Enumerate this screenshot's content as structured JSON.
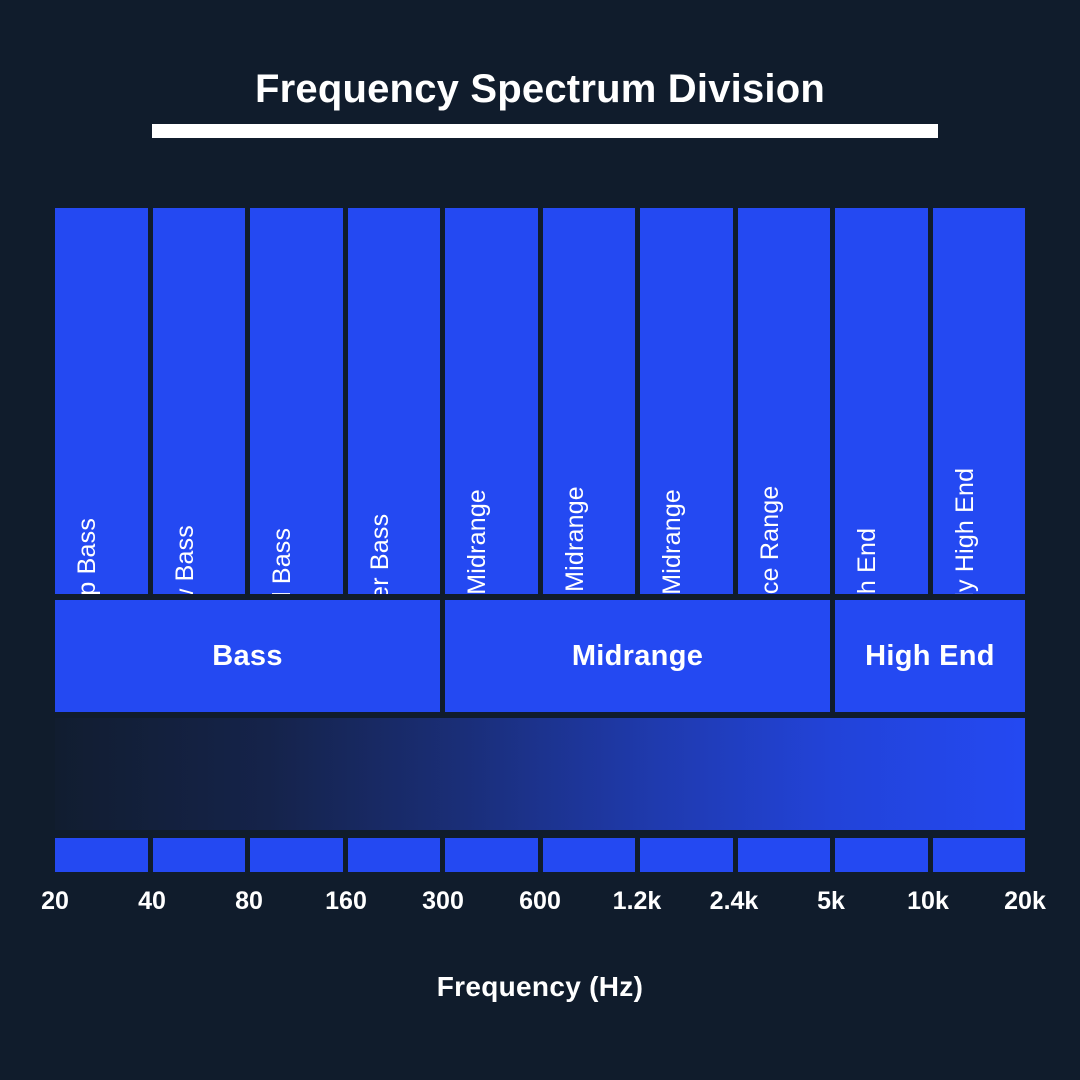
{
  "title": "Frequency Spectrum Division",
  "axis_title": "Frequency (Hz)",
  "colors": {
    "background": "#101c2c",
    "band": "#2449f2",
    "text": "#ffffff",
    "gradient_start": "#111d30",
    "gradient_end": "#2449f2"
  },
  "chart_data": {
    "type": "bar",
    "title": "Frequency Spectrum Division",
    "xlabel": "Frequency (Hz)",
    "ylabel": "",
    "grid": false,
    "legend": "none",
    "axis_scale": "logarithmic",
    "tick_labels": [
      "20",
      "40",
      "80",
      "160",
      "300",
      "600",
      "1.2k",
      "2.4k",
      "5k",
      "10k",
      "20k"
    ],
    "tick_values": [
      20,
      40,
      80,
      160,
      300,
      600,
      1200,
      2400,
      5000,
      10000,
      20000
    ],
    "categories": [
      "Deep Bass",
      "Low Bass",
      "Mid Bass",
      "Upper Bass",
      "Lower Midrange",
      "Middle Midrange",
      "Upper Midrange",
      "Presence Range",
      "High End",
      "Extremely High End"
    ],
    "bands": [
      {
        "label": "Deep Bass",
        "from": "20",
        "to": "40"
      },
      {
        "label": "Low Bass",
        "from": "40",
        "to": "80"
      },
      {
        "label": "Mid Bass",
        "from": "80",
        "to": "160"
      },
      {
        "label": "Upper Bass",
        "from": "160",
        "to": "300"
      },
      {
        "label": "Lower Midrange",
        "from": "300",
        "to": "600"
      },
      {
        "label": "Middle Midrange",
        "from": "600",
        "to": "1.2k"
      },
      {
        "label": "Upper Midrange",
        "from": "1.2k",
        "to": "2.4k"
      },
      {
        "label": "Presence Range",
        "from": "2.4k",
        "to": "5k"
      },
      {
        "label": "High End",
        "from": "5k",
        "to": "10k"
      },
      {
        "label": "Extremely High End",
        "from": "10k",
        "to": "20k"
      }
    ],
    "groups": [
      {
        "label": "Bass",
        "span": 4
      },
      {
        "label": "Midrange",
        "span": 4
      },
      {
        "label": "High End",
        "span": 2
      }
    ]
  }
}
